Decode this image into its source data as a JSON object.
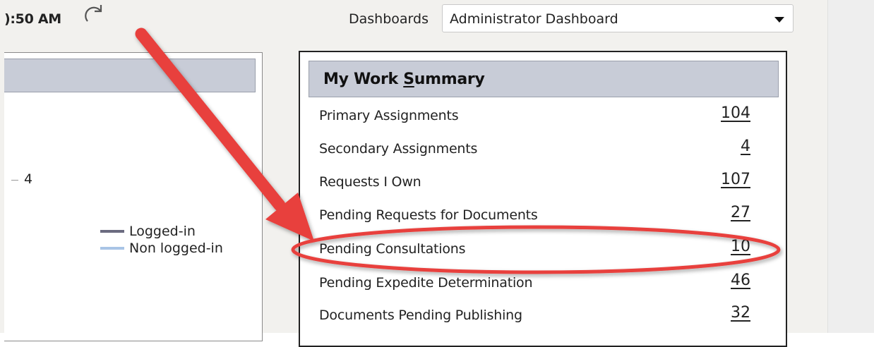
{
  "header": {
    "time_fragment": "):50 AM",
    "dashboards_label": "Dashboards",
    "dashboard_selected": "Administrator Dashboard"
  },
  "left_panel": {
    "axis_value": "4",
    "legend": [
      {
        "label": "Logged-in",
        "color": "#6b6b80"
      },
      {
        "label": "Non logged-in",
        "color": "#a9c4e6"
      }
    ]
  },
  "summary": {
    "title_pre": "My Work ",
    "title_ul": "S",
    "title_post": "ummary",
    "rows": [
      {
        "label": "Primary Assignments",
        "value": "104"
      },
      {
        "label": "Secondary Assignments",
        "value": "4"
      },
      {
        "label": "Requests I Own",
        "value": "107"
      },
      {
        "label": "Pending Requests for Documents",
        "value": "27"
      },
      {
        "label": "Pending Consultations",
        "value": "10"
      },
      {
        "label": "Pending Expedite Determination",
        "value": "46"
      },
      {
        "label": "Documents Pending Publishing",
        "value": "32"
      }
    ]
  },
  "colors": {
    "annotation_red": "#e8403d",
    "panel_header": "#c8ccd7"
  }
}
